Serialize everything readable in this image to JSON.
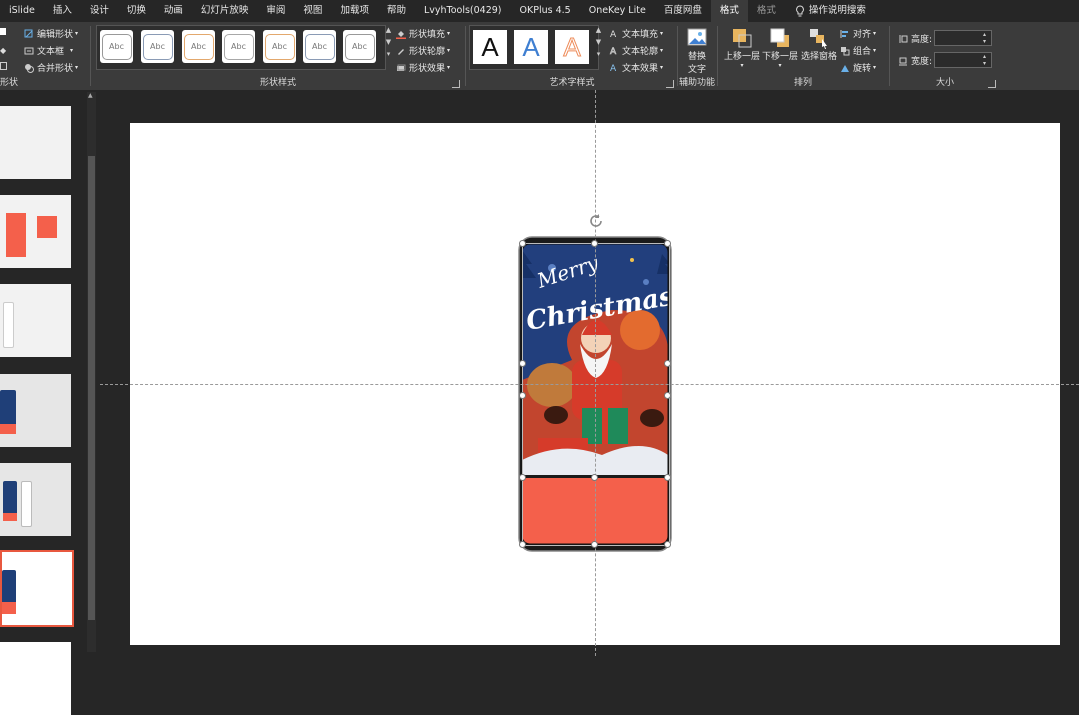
{
  "menu": {
    "tabs": [
      "iSlide",
      "插入",
      "设计",
      "切换",
      "动画",
      "幻灯片放映",
      "审阅",
      "视图",
      "加载项",
      "帮助",
      "LvyhTools(0429)",
      "OKPlus 4.5",
      "OneKey Lite",
      "百度网盘",
      "格式",
      "格式"
    ],
    "active_index": 14,
    "search_label": "操作说明搜索"
  },
  "ribbon": {
    "insert_shapes": {
      "edit_shape": "编辑形状",
      "text_box": "文本框",
      "merge_shapes": "合并形状",
      "group_label": "形状"
    },
    "shape_styles": {
      "preset_text": "Abc",
      "fill": "形状填充",
      "outline": "形状轮廓",
      "effects": "形状效果",
      "group_label": "形状样式",
      "preset_colors": [
        "#999999",
        "#8a9bb5",
        "#e3a86d",
        "#a8a8a8",
        "#e3a86d",
        "#8a9bb5",
        "#999999"
      ]
    },
    "wordart": {
      "letter": "A",
      "text_fill": "文本填充",
      "text_outline": "文本轮廓",
      "text_effects": "文本效果",
      "group_label": "艺术字样式"
    },
    "accessibility": {
      "alt_text_line1": "替换",
      "alt_text_line2": "文字",
      "group_label": "辅助功能"
    },
    "arrange": {
      "bring_forward": "上移一层",
      "send_backward": "下移一层",
      "selection_pane": "选择窗格",
      "align": "对齐",
      "group": "组合",
      "rotate": "旋转",
      "group_label": "排列"
    },
    "size": {
      "height_label": "高度:",
      "width_label": "宽度:",
      "height_value": "",
      "width_value": "",
      "group_label": "大小"
    }
  },
  "image": {
    "greeting_line1": "Merry",
    "greeting_line2": "Christmas",
    "accent_color": "#f4604b"
  }
}
